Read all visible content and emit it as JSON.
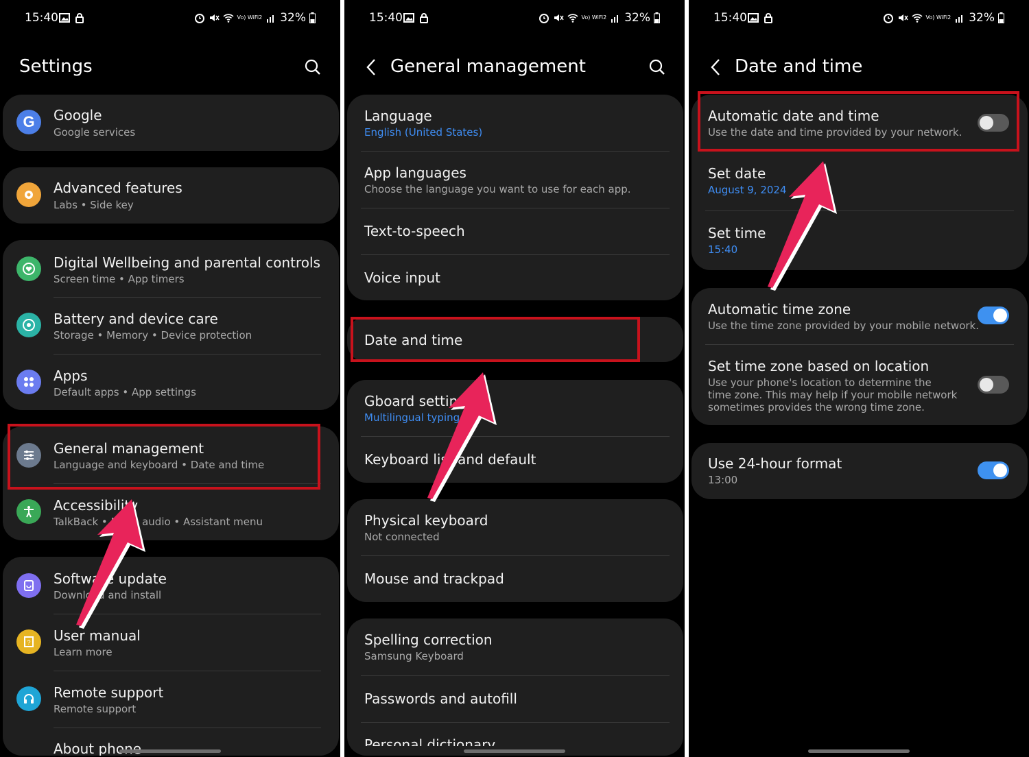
{
  "status": {
    "time": "15:40",
    "wifi_label": "Vo) WiFi2",
    "battery": "32%"
  },
  "screen1": {
    "title": "Settings",
    "items": [
      {
        "label": "Google",
        "sub": "Google services"
      },
      {
        "label": "Advanced features",
        "sub": "Labs  •  Side key"
      },
      {
        "label": "Digital Wellbeing and parental controls",
        "sub": "Screen time  •  App timers"
      },
      {
        "label": "Battery and device care",
        "sub": "Storage  •  Memory  •  Device protection"
      },
      {
        "label": "Apps",
        "sub": "Default apps  •  App settings"
      },
      {
        "label": "General management",
        "sub": "Language and keyboard  •  Date and time"
      },
      {
        "label": "Accessibility",
        "sub": "TalkBack  •  Mono audio  •  Assistant menu"
      },
      {
        "label": "Software update",
        "sub": "Download and install"
      },
      {
        "label": "User manual",
        "sub": "Learn more"
      },
      {
        "label": "Remote support",
        "sub": "Remote support"
      },
      {
        "label": "About phone",
        "sub": ""
      }
    ]
  },
  "screen2": {
    "title": "General management",
    "items": [
      {
        "label": "Language",
        "sub": "English (United States)"
      },
      {
        "label": "App languages",
        "sub": "Choose the language you want to use for each app."
      },
      {
        "label": "Text-to-speech"
      },
      {
        "label": "Voice input"
      },
      {
        "label": "Date and time"
      },
      {
        "label": "Gboard settings",
        "sub": "Multilingual typing"
      },
      {
        "label": "Keyboard list and default"
      },
      {
        "label": "Physical keyboard",
        "sub": "Not connected"
      },
      {
        "label": "Mouse and trackpad"
      },
      {
        "label": "Spelling correction",
        "sub": "Samsung Keyboard"
      },
      {
        "label": "Passwords and autofill"
      },
      {
        "label": "Personal dictionary"
      }
    ]
  },
  "screen3": {
    "title": "Date and time",
    "auto_datetime": {
      "label": "Automatic date and time",
      "sub": "Use the date and time provided by your network.",
      "enabled": false
    },
    "set_date": {
      "label": "Set date",
      "value": "August 9, 2024"
    },
    "set_time": {
      "label": "Set time",
      "value": "15:40"
    },
    "auto_timezone": {
      "label": "Automatic time zone",
      "sub": "Use the time zone provided by your mobile network.",
      "enabled": true
    },
    "tz_location": {
      "label": "Set time zone based on location",
      "sub1": "Use your phone's location to determine the",
      "sub2": "time zone. This may help if your mobile network",
      "sub3": "sometimes provides the wrong time zone.",
      "enabled": false
    },
    "format24": {
      "label": "Use 24-hour format",
      "sub": "13:00",
      "enabled": true
    }
  },
  "colors": {
    "highlight": "#c8121c",
    "accent": "#3e91f0",
    "arrow": "#e8245a"
  }
}
